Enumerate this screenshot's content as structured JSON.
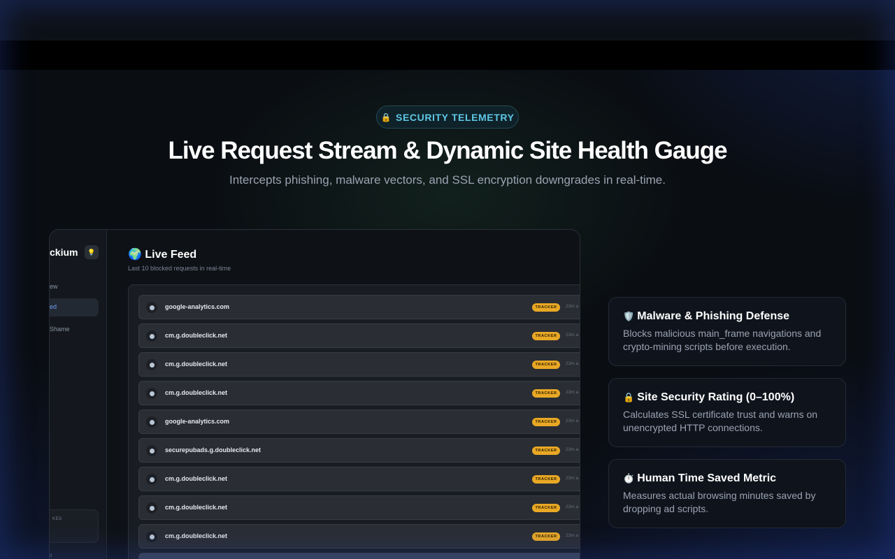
{
  "hero": {
    "badge_icon": "lock-icon",
    "badge_label": "SECURITY TELEMETRY",
    "title": "Live Request Stream & Dynamic Site Health Gauge",
    "subtitle": "Intercepts phishing, malware vectors, and SSL encryption downgrades in real-time."
  },
  "app": {
    "brand_fragment": "ckium",
    "theme_icon": "bulb-icon",
    "sidebar_items": [
      "ew",
      "ed",
      "Shame"
    ],
    "sidebar_card_label": "KED",
    "sidebar_footer": "3",
    "feed_icon": "globe-icon",
    "feed_title": "Live Feed",
    "feed_subtitle": "Last 10 blocked requests in real-time",
    "rows": [
      {
        "domain": "google-analytics.com",
        "tag": "TRACKER",
        "time": "23m a"
      },
      {
        "domain": "cm.g.doubleclick.net",
        "tag": "TRACKER",
        "time": "23m a"
      },
      {
        "domain": "cm.g.doubleclick.net",
        "tag": "TRACKER",
        "time": "23m a"
      },
      {
        "domain": "cm.g.doubleclick.net",
        "tag": "TRACKER",
        "time": "23m a"
      },
      {
        "domain": "google-analytics.com",
        "tag": "TRACKER",
        "time": "23m a"
      },
      {
        "domain": "securepubads.g.doubleclick.net",
        "tag": "TRACKER",
        "time": "23m a"
      },
      {
        "domain": "cm.g.doubleclick.net",
        "tag": "TRACKER",
        "time": "23m a"
      },
      {
        "domain": "cm.g.doubleclick.net",
        "tag": "TRACKER",
        "time": "23m a"
      },
      {
        "domain": "cm.g.doubleclick.net",
        "tag": "TRACKER",
        "time": "23m a"
      }
    ]
  },
  "features": [
    {
      "icon": "shield-icon",
      "title": "Malware & Phishing Defense",
      "desc": "Blocks malicious main_frame navigations and crypto-mining scripts before execution."
    },
    {
      "icon": "lock-icon",
      "title": "Site Security Rating (0–100%)",
      "desc": "Calculates SSL certificate trust and warns on unencrypted HTTP connections."
    },
    {
      "icon": "stopwatch-icon",
      "title": "Human Time Saved Metric",
      "desc": "Measures actual browsing minutes saved by dropping ad scripts."
    }
  ],
  "colors": {
    "accent": "#5fc7e6",
    "tracker_tag": "#e9a825",
    "active_nav": "#6f9cf5"
  }
}
